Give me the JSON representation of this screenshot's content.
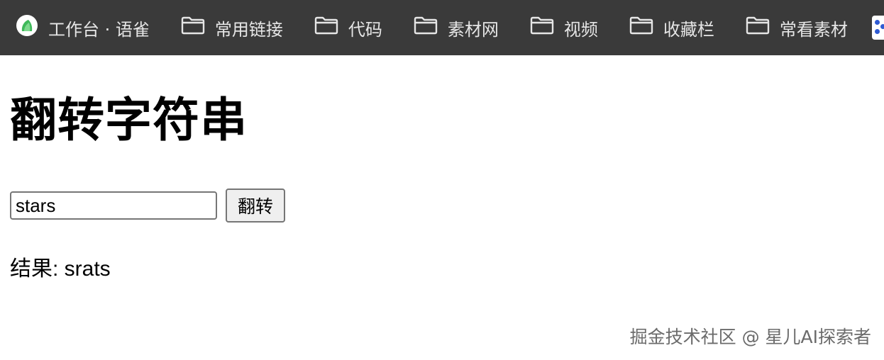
{
  "bookmarks": [
    {
      "label": "工作台 · 语雀",
      "icon": "yuque-logo-icon"
    },
    {
      "label": "常用链接",
      "icon": "folder-icon"
    },
    {
      "label": "代码",
      "icon": "folder-icon"
    },
    {
      "label": "素材网",
      "icon": "folder-icon"
    },
    {
      "label": "视频",
      "icon": "folder-icon"
    },
    {
      "label": "收藏栏",
      "icon": "folder-icon"
    },
    {
      "label": "常看素材",
      "icon": "folder-icon"
    }
  ],
  "page": {
    "title": "翻转字符串",
    "input_value": "stars",
    "button_label": "翻转",
    "result_text": "结果: srats"
  },
  "watermark": "掘金技术社区 @ 星儿AI探索者",
  "colors": {
    "bar_background": "#3a3a3a",
    "bar_text": "#e6e6e6",
    "button_background": "#efefef"
  }
}
